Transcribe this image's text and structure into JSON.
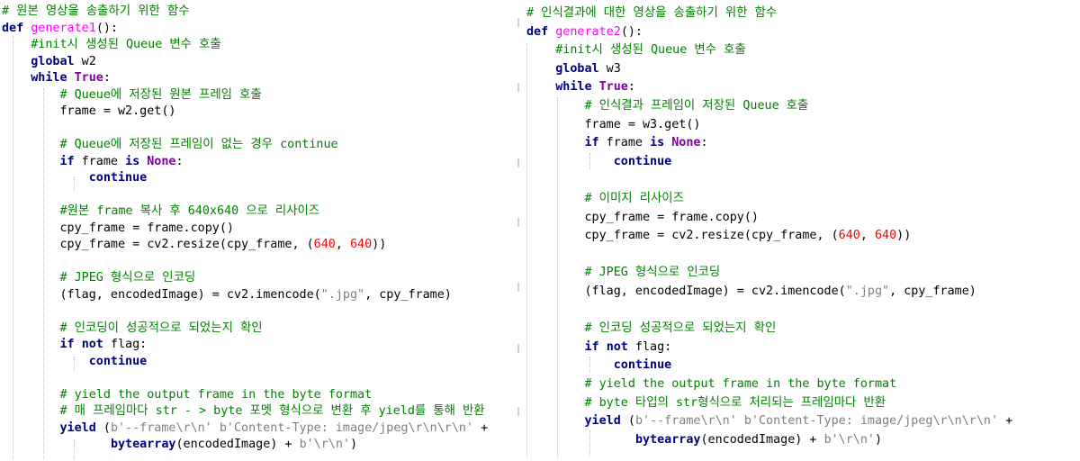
{
  "left": {
    "lines": [
      [
        {
          "t": "# 원본 영상을 송출하기 위한 함수",
          "c": "cm"
        }
      ],
      [
        {
          "t": "def ",
          "c": "kw"
        },
        {
          "t": "generate1",
          "c": "fn"
        },
        {
          "t": "():",
          "c": ""
        }
      ],
      [
        {
          "t": "    #init시 생성된 Queue 변수 호출",
          "c": "cm"
        }
      ],
      [
        {
          "t": "    ",
          "c": ""
        },
        {
          "t": "global",
          "c": "kw"
        },
        {
          "t": " w2",
          "c": ""
        }
      ],
      [
        {
          "t": "    ",
          "c": ""
        },
        {
          "t": "while",
          "c": "kw"
        },
        {
          "t": " ",
          "c": ""
        },
        {
          "t": "True",
          "c": "const"
        },
        {
          "t": ":",
          "c": ""
        }
      ],
      [
        {
          "t": "        # Queue에 저장된 원본 프레임 호출",
          "c": "cm"
        }
      ],
      [
        {
          "t": "        frame = w2.get()",
          "c": ""
        }
      ],
      [
        {
          "t": "",
          "c": ""
        }
      ],
      [
        {
          "t": "        # Queue에 저장된 프레임이 없는 경우 continue",
          "c": "cm"
        }
      ],
      [
        {
          "t": "        ",
          "c": ""
        },
        {
          "t": "if",
          "c": "kw"
        },
        {
          "t": " frame ",
          "c": ""
        },
        {
          "t": "is",
          "c": "kw"
        },
        {
          "t": " ",
          "c": ""
        },
        {
          "t": "None",
          "c": "const"
        },
        {
          "t": ":",
          "c": ""
        }
      ],
      [
        {
          "t": "            ",
          "c": ""
        },
        {
          "t": "continue",
          "c": "kw"
        }
      ],
      [
        {
          "t": "",
          "c": ""
        }
      ],
      [
        {
          "t": "        #원본 frame 복사 후 640x640 으로 리사이즈",
          "c": "cm"
        }
      ],
      [
        {
          "t": "        cpy_frame = frame.copy()",
          "c": ""
        }
      ],
      [
        {
          "t": "        cpy_frame = cv2.resize(cpy_frame, (",
          "c": ""
        },
        {
          "t": "640",
          "c": "num"
        },
        {
          "t": ", ",
          "c": ""
        },
        {
          "t": "640",
          "c": "num"
        },
        {
          "t": "))",
          "c": ""
        }
      ],
      [
        {
          "t": "",
          "c": ""
        }
      ],
      [
        {
          "t": "        # JPEG 형식으로 인코딩",
          "c": "cm"
        }
      ],
      [
        {
          "t": "        (flag, encodedImage) = cv2.imencode(",
          "c": ""
        },
        {
          "t": "\".jpg\"",
          "c": "str"
        },
        {
          "t": ", cpy_frame)",
          "c": ""
        }
      ],
      [
        {
          "t": "",
          "c": ""
        }
      ],
      [
        {
          "t": "        # 인코딩이 성공적으로 되었는지 확인",
          "c": "cm"
        }
      ],
      [
        {
          "t": "        ",
          "c": ""
        },
        {
          "t": "if",
          "c": "kw"
        },
        {
          "t": " ",
          "c": ""
        },
        {
          "t": "not",
          "c": "kw"
        },
        {
          "t": " flag:",
          "c": ""
        }
      ],
      [
        {
          "t": "            ",
          "c": ""
        },
        {
          "t": "continue",
          "c": "kw"
        }
      ],
      [
        {
          "t": "",
          "c": ""
        }
      ],
      [
        {
          "t": "        # yield the output frame in the byte format",
          "c": "cm"
        }
      ],
      [
        {
          "t": "        # 매 프레임마다 str - > byte 포멧 형식으로 변환 후 yield를 통해 반환",
          "c": "cm"
        }
      ],
      [
        {
          "t": "        ",
          "c": ""
        },
        {
          "t": "yield",
          "c": "kw"
        },
        {
          "t": " (",
          "c": ""
        },
        {
          "t": "b'--frame\\r\\n' b'Content-Type: image/jpeg\\r\\n\\r\\n'",
          "c": "str"
        },
        {
          "t": " +",
          "c": ""
        }
      ],
      [
        {
          "t": "               ",
          "c": ""
        },
        {
          "t": "bytearray",
          "c": "bi"
        },
        {
          "t": "(encodedImage) + ",
          "c": ""
        },
        {
          "t": "b'\\r\\n'",
          "c": "str"
        },
        {
          "t": ")",
          "c": ""
        }
      ]
    ]
  },
  "right": {
    "lines": [
      [
        {
          "t": "# 인식결과에 대한 영상을 송출하기 위한 함수",
          "c": "cm"
        }
      ],
      [
        {
          "t": "def ",
          "c": "kw"
        },
        {
          "t": "generate2",
          "c": "fn"
        },
        {
          "t": "():",
          "c": ""
        }
      ],
      [
        {
          "t": "    #init시 생성된 Queue 변수 호출",
          "c": "cm"
        }
      ],
      [
        {
          "t": "    ",
          "c": ""
        },
        {
          "t": "global",
          "c": "kw"
        },
        {
          "t": " w3",
          "c": ""
        }
      ],
      [
        {
          "t": "    ",
          "c": ""
        },
        {
          "t": "while",
          "c": "kw"
        },
        {
          "t": " ",
          "c": ""
        },
        {
          "t": "True",
          "c": "const"
        },
        {
          "t": ":",
          "c": ""
        }
      ],
      [
        {
          "t": "        # 인식결과 프레임이 저장된 Queue 호출",
          "c": "cm"
        }
      ],
      [
        {
          "t": "        frame = w3.get()",
          "c": ""
        }
      ],
      [
        {
          "t": "        ",
          "c": ""
        },
        {
          "t": "if",
          "c": "kw"
        },
        {
          "t": " frame ",
          "c": ""
        },
        {
          "t": "is",
          "c": "kw"
        },
        {
          "t": " ",
          "c": ""
        },
        {
          "t": "None",
          "c": "const"
        },
        {
          "t": ":",
          "c": ""
        }
      ],
      [
        {
          "t": "            ",
          "c": ""
        },
        {
          "t": "continue",
          "c": "kw"
        }
      ],
      [
        {
          "t": "",
          "c": ""
        }
      ],
      [
        {
          "t": "        # 이미지 리사이즈",
          "c": "cm"
        }
      ],
      [
        {
          "t": "        cpy_frame = frame.copy()",
          "c": ""
        }
      ],
      [
        {
          "t": "        cpy_frame = cv2.resize(cpy_frame, (",
          "c": ""
        },
        {
          "t": "640",
          "c": "num"
        },
        {
          "t": ", ",
          "c": ""
        },
        {
          "t": "640",
          "c": "num"
        },
        {
          "t": "))",
          "c": ""
        }
      ],
      [
        {
          "t": "",
          "c": ""
        }
      ],
      [
        {
          "t": "        # JPEG 형식으로 인코딩",
          "c": "cm"
        }
      ],
      [
        {
          "t": "        (flag, encodedImage) = cv2.imencode(",
          "c": ""
        },
        {
          "t": "\".jpg\"",
          "c": "str"
        },
        {
          "t": ", cpy_frame)",
          "c": ""
        }
      ],
      [
        {
          "t": "",
          "c": ""
        }
      ],
      [
        {
          "t": "        # 인코딩 성공적으로 되었는지 확인",
          "c": "cm"
        }
      ],
      [
        {
          "t": "        ",
          "c": ""
        },
        {
          "t": "if",
          "c": "kw"
        },
        {
          "t": " ",
          "c": ""
        },
        {
          "t": "not",
          "c": "kw"
        },
        {
          "t": " flag:",
          "c": ""
        }
      ],
      [
        {
          "t": "            ",
          "c": ""
        },
        {
          "t": "continue",
          "c": "kw"
        }
      ],
      [
        {
          "t": "        # yield the output frame in the byte format",
          "c": "cm"
        }
      ],
      [
        {
          "t": "        # byte 타입의 str형식으로 처리되는 프레임마다 반환",
          "c": "cm"
        }
      ],
      [
        {
          "t": "        ",
          "c": ""
        },
        {
          "t": "yield",
          "c": "kw"
        },
        {
          "t": " (",
          "c": ""
        },
        {
          "t": "b'--frame\\r\\n' b'Content-Type: image/jpeg\\r\\n\\r\\n'",
          "c": "str"
        },
        {
          "t": " +",
          "c": ""
        }
      ],
      [
        {
          "t": "               ",
          "c": ""
        },
        {
          "t": "bytearray",
          "c": "bi"
        },
        {
          "t": "(encodedImage) + ",
          "c": ""
        },
        {
          "t": "b'\\r\\n'",
          "c": "str"
        },
        {
          "t": ")",
          "c": ""
        }
      ]
    ]
  }
}
